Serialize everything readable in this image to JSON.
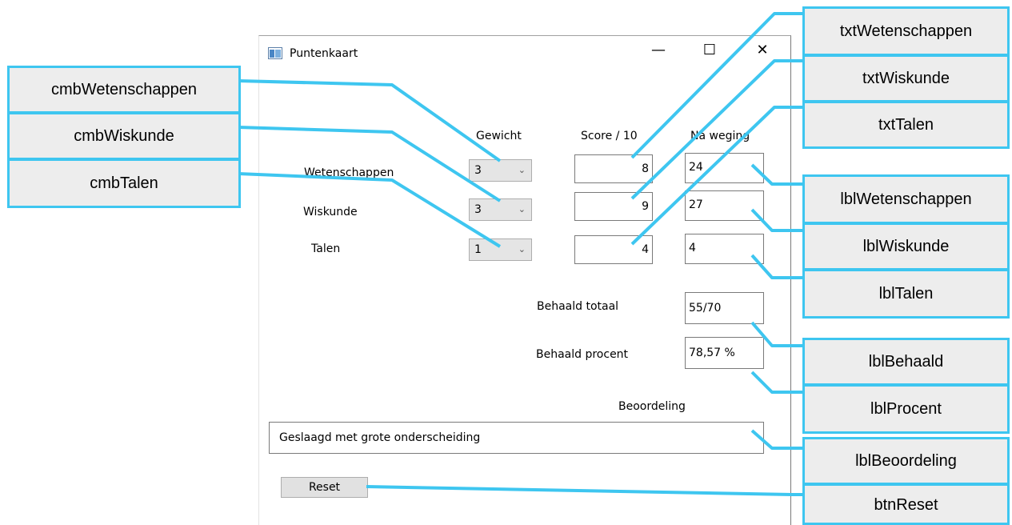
{
  "window": {
    "title": "Puntenkaart",
    "controls": {
      "minimize": "—",
      "maximize": "☐",
      "close": "✕"
    }
  },
  "headers": {
    "gewicht": "Gewicht",
    "score": "Score / 10",
    "na_weging": "Na weging"
  },
  "rows": [
    {
      "label": "Wetenschappen",
      "weight": "3",
      "score": "8",
      "weighted": "24"
    },
    {
      "label": "Wiskunde",
      "weight": "3",
      "score": "9",
      "weighted": "27"
    },
    {
      "label": "Talen",
      "weight": "1",
      "score": "4",
      "weighted": "4"
    }
  ],
  "totals": {
    "behaald_label": "Behaald totaal",
    "behaald_value": "55/70",
    "procent_label": "Behaald procent",
    "procent_value": "78,57 %"
  },
  "beoordeling": {
    "label": "Beoordeling",
    "value": "Geslaagd met grote onderscheiding"
  },
  "reset_label": "Reset",
  "callouts": {
    "left": [
      "cmbWetenschappen",
      "cmbWiskunde",
      "cmbTalen"
    ],
    "right_top": [
      "txtWetenschappen",
      "txtWiskunde",
      "txtTalen"
    ],
    "right": [
      "lblWetenschappen",
      "lblWiskunde",
      "lblTalen",
      "lblBehaald",
      "lblProcent",
      "lblBeoordeling",
      "btnReset"
    ]
  },
  "colors": {
    "callout_border": "#3ec6f0",
    "callout_fill": "#ededed"
  }
}
